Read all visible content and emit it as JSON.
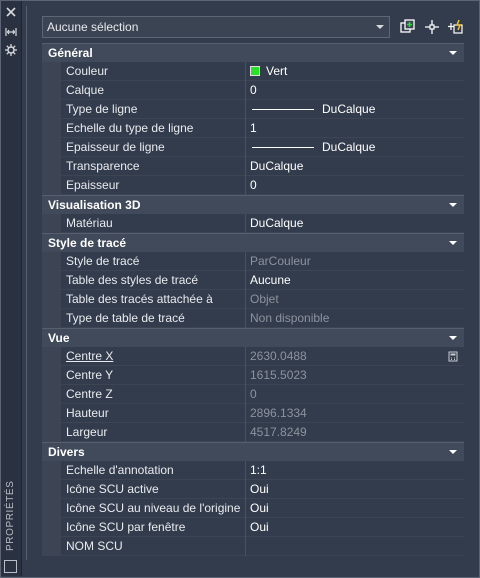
{
  "panel": {
    "vertical_title": "PROPRIÉTÉS"
  },
  "toolbar": {
    "selection_value": "Aucune sélection",
    "icons": [
      "toggle-pickadd-icon",
      "select-objects-icon",
      "quick-select-icon"
    ]
  },
  "colors": {
    "background": "#333c4c",
    "section_header": "#414a5a",
    "swatch_green": "#27e027",
    "dim_text": "#8d939e"
  },
  "sections": [
    {
      "title": "Général",
      "rows": [
        {
          "name": "Couleur",
          "value": "Vert",
          "swatch": true
        },
        {
          "name": "Calque",
          "value": "0"
        },
        {
          "name": "Type de ligne",
          "value": "DuCalque",
          "line": true
        },
        {
          "name": "Echelle du type de ligne",
          "value": "1"
        },
        {
          "name": "Epaisseur de ligne",
          "value": "DuCalque",
          "line": true
        },
        {
          "name": "Transparence",
          "value": "DuCalque"
        },
        {
          "name": "Epaisseur",
          "value": "0"
        }
      ]
    },
    {
      "title": "Visualisation 3D",
      "rows": [
        {
          "name": "Matériau",
          "value": "DuCalque"
        }
      ]
    },
    {
      "title": "Style de tracé",
      "rows": [
        {
          "name": "Style de tracé",
          "value": "ParCouleur",
          "dim": true
        },
        {
          "name": "Table des styles de tracé",
          "value": "Aucune"
        },
        {
          "name": "Table des tracés attachée à",
          "value": "Objet",
          "dim": true
        },
        {
          "name": "Type de table de tracé",
          "value": "Non disponible",
          "dim": true
        }
      ]
    },
    {
      "title": "Vue",
      "rows": [
        {
          "name": "Centre X",
          "value": "2630.0488",
          "dim": true,
          "calc": true
        },
        {
          "name": "Centre Y",
          "value": "1615.5023",
          "dim": true
        },
        {
          "name": "Centre Z",
          "value": "0",
          "dim": true
        },
        {
          "name": "Hauteur",
          "value": "2896.1334",
          "dim": true
        },
        {
          "name": "Largeur",
          "value": "4517.8249",
          "dim": true
        }
      ]
    },
    {
      "title": "Divers",
      "rows": [
        {
          "name": "Echelle d'annotation",
          "value": "1:1"
        },
        {
          "name": "Icône SCU active",
          "value": "Oui"
        },
        {
          "name": "Icône SCU au niveau de l'origine",
          "value": "Oui"
        },
        {
          "name": "Icône SCU par fenêtre",
          "value": "Oui"
        },
        {
          "name": "NOM SCU",
          "value": ""
        }
      ]
    }
  ]
}
